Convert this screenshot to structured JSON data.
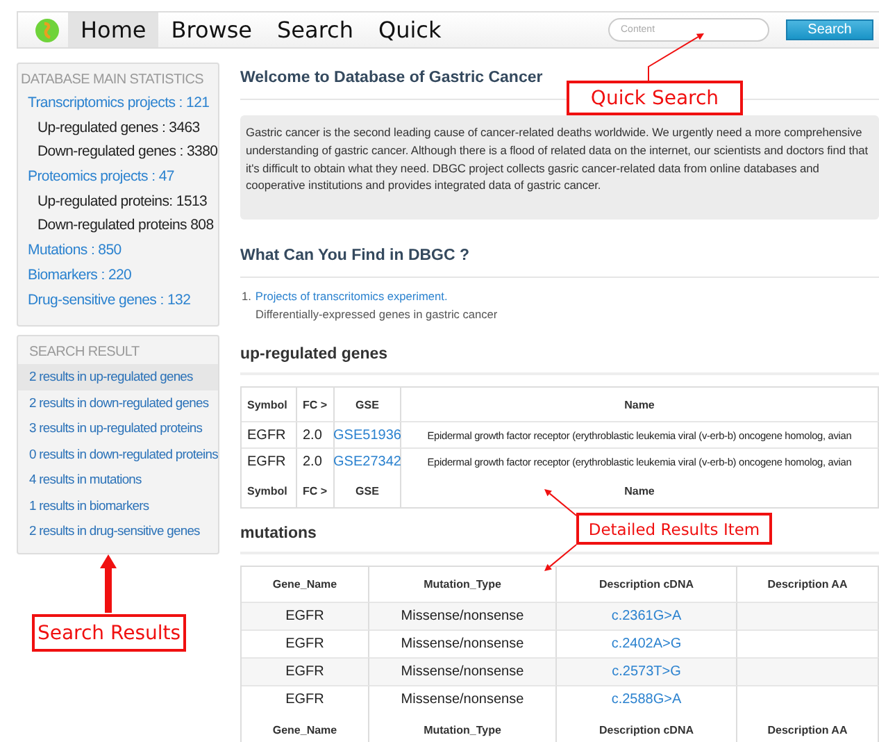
{
  "nav": {
    "items": [
      {
        "label": "Home",
        "selected": true
      },
      {
        "label": "Browse",
        "selected": false
      },
      {
        "label": "Search",
        "selected": false
      },
      {
        "label": "Quick",
        "selected": false
      }
    ],
    "search": {
      "placeholder": "Content",
      "button": "Search"
    }
  },
  "statistics": {
    "title": "DATABASE MAIN STATISTICS",
    "items": [
      {
        "kind": "project",
        "text": "Transcriptomics projects : 121"
      },
      {
        "kind": "sub",
        "text": "Up-regulated genes : 3463"
      },
      {
        "kind": "sub",
        "text": "Down-regulated genes : 3380"
      },
      {
        "kind": "project",
        "text": "Proteomics projects : 47"
      },
      {
        "kind": "sub",
        "text": "Up-regulated proteins: 1513"
      },
      {
        "kind": "sub",
        "text": "Down-regulated proteins 808"
      },
      {
        "kind": "project",
        "text": "Mutations : 850"
      },
      {
        "kind": "project",
        "text": "Biomarkers : 220"
      },
      {
        "kind": "project",
        "text": "Drug-sensitive genes : 132"
      }
    ]
  },
  "search_result": {
    "title": "SEARCH RESULT",
    "items": [
      {
        "text": "2 results in up-regulated genes",
        "selected": true
      },
      {
        "text": "2 results in down-regulated genes",
        "selected": false
      },
      {
        "text": "3 results in up-regulated proteins",
        "selected": false
      },
      {
        "text": "0 results in down-regulated proteins",
        "selected": false
      },
      {
        "text": "4 results in mutations",
        "selected": false
      },
      {
        "text": "1 results in biomarkers",
        "selected": false
      },
      {
        "text": "2 results in drug-sensitive genes",
        "selected": false
      }
    ]
  },
  "welcome": {
    "title": "Welcome to Database of Gastric Cancer",
    "text": "Gastric cancer is the second leading cause of cancer-related deaths worldwide. We urgently need a more comprehensive understanding of gastric cancer. Although there is a flood of related data on the internet, our scientists and doctors find that it's difficult to obtain what they need. DBGC project collects gasric cancer-related data from online databases and cooperative institutions and provides integrated data of gastric cancer."
  },
  "features": {
    "title": "What Can You Find in DBGC ?",
    "items": [
      {
        "number": "1.",
        "title": "Projects of transcritomics experiment.",
        "description": "Differentially-expressed genes in gastric cancer"
      }
    ]
  },
  "up_regulated_genes": {
    "title": "up-regulated genes",
    "columns": [
      "Symbol",
      "FC >",
      "GSE",
      "Name"
    ],
    "rows": [
      [
        "EGFR",
        "2.0",
        "GSE51936",
        "Epidermal growth factor receptor (erythroblastic leukemia viral (v-erb-b) oncogene homolog, avian"
      ],
      [
        "EGFR",
        "2.0",
        "GSE27342",
        "Epidermal growth factor receptor (erythroblastic leukemia viral (v-erb-b) oncogene homolog, avian"
      ]
    ],
    "footer_columns": [
      "Symbol",
      "FC >",
      "GSE",
      "Name"
    ]
  },
  "mutations": {
    "title": "mutations",
    "columns": [
      "Gene_Name",
      "Mutation_Type",
      "Description cDNA",
      "Description AA"
    ],
    "rows": [
      [
        "EGFR",
        "Missense/nonsense",
        "c.2361G>A",
        ""
      ],
      [
        "EGFR",
        "Missense/nonsense",
        "c.2402A>G",
        ""
      ],
      [
        "EGFR",
        "Missense/nonsense",
        "c.2573T>G",
        ""
      ],
      [
        "EGFR",
        "Missense/nonsense",
        "c.2588G>A",
        ""
      ]
    ],
    "footer_columns": [
      "Gene_Name",
      "Mutation_Type",
      "Description cDNA",
      "Description AA"
    ]
  },
  "annotations": [
    {
      "kind": "quick-search",
      "text": "Quick Search"
    },
    {
      "kind": "detail",
      "text": "Detailed Results Item"
    },
    {
      "kind": "results",
      "text": "Search Results"
    }
  ]
}
